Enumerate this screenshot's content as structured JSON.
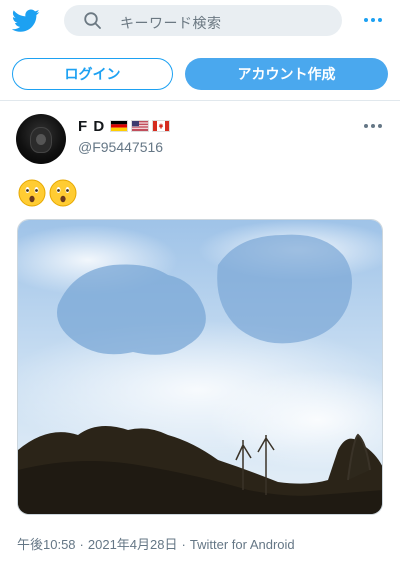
{
  "topbar": {
    "logo": "twitter-bird-logo",
    "search_placeholder": "キーワード検索",
    "more_icon": "more-horizontal-icon"
  },
  "auth": {
    "login_label": "ログイン",
    "signup_label": "アカウント作成"
  },
  "tweet": {
    "display_name": "F D",
    "flags": [
      "germany-flag",
      "usa-flag",
      "canada-flag"
    ],
    "handle": "@F95447516",
    "emojis": [
      "astonished-face-emoji",
      "astonished-face-emoji"
    ],
    "media": "video-thumbnail-sky-clouds-trees",
    "time": "午後10:58",
    "date": "2021年4月28日",
    "source": "Twitter for Android",
    "separator": "·"
  },
  "colors": {
    "accent": "#1da1f2",
    "signup_bg": "#4aa8ee",
    "search_bg": "#e9eef2",
    "muted_text": "#657786"
  }
}
